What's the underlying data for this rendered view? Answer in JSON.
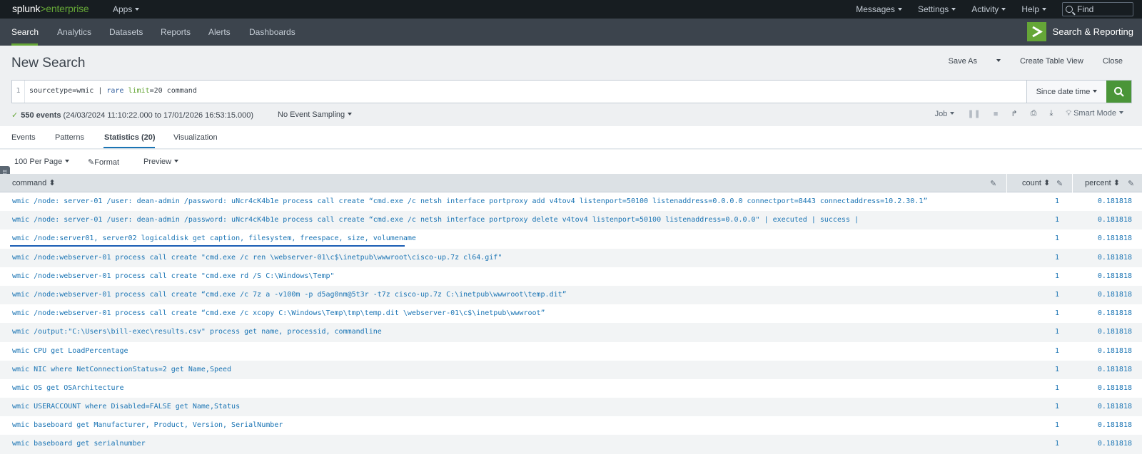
{
  "topbar": {
    "logo_brand": "splunk",
    "logo_gt": ">",
    "logo_product": "enterprise",
    "apps_label": "Apps",
    "menu": [
      "Messages",
      "Settings",
      "Activity",
      "Help"
    ],
    "find_placeholder": "Find"
  },
  "navbar": {
    "items": [
      "Search",
      "Analytics",
      "Datasets",
      "Reports",
      "Alerts",
      "Dashboards"
    ],
    "active": "Search",
    "app_name": "Search & Reporting",
    "accent_color": "#65a637"
  },
  "page": {
    "title": "New Search",
    "actions": {
      "save_as": "Save As",
      "create_table_view": "Create Table View",
      "close": "Close"
    }
  },
  "search": {
    "line_number": "1",
    "query_plain": "sourcetype=wmic | ",
    "query_command": "rare",
    "query_arg": "limit",
    "query_rest": "=20 command",
    "time_range": "Since date time"
  },
  "status": {
    "events_count": "550 events",
    "range": "(24/03/2024 11:10:22.000 to 17/01/2026 16:53:15.000)",
    "sampling": "No Event Sampling",
    "job": "Job",
    "mode": "Smart Mode"
  },
  "tabs": [
    "Events",
    "Patterns",
    "Statistics (20)",
    "Visualization"
  ],
  "active_tab": "Statistics (20)",
  "options": {
    "per_page": "100 Per Page",
    "format": "Format",
    "preview": "Preview"
  },
  "table": {
    "columns": [
      "command",
      "count",
      "percent"
    ],
    "rows": [
      {
        "command": "wmic /node: server-01 /user: dean-admin /password: uNcr4cK4b1e process call create “cmd.exe /c netsh interface portproxy add v4tov4 listenport=50100 listenaddress=0.0.0.0 connectport=8443 connectaddress=10.2.30.1”",
        "count": "1",
        "percent": "0.181818"
      },
      {
        "command": "wmic /node: server-01 /user: dean-admin /password: uNcr4cK4b1e process call create “cmd.exe /c netsh interface portproxy delete v4tov4 listenport=50100 listenaddress=0.0.0.0\" | executed | success |",
        "count": "1",
        "percent": "0.181818"
      },
      {
        "command": "wmic /node:server01, server02 logicaldisk get caption, filesystem, freespace, size, volumename",
        "count": "1",
        "percent": "0.181818"
      },
      {
        "command": "wmic /node:webserver-01 process call create \"cmd.exe /c ren \\webserver-01\\c$\\inetpub\\wwwroot\\cisco-up.7z cl64.gif\"",
        "count": "1",
        "percent": "0.181818"
      },
      {
        "command": "wmic /node:webserver-01 process call create \"cmd.exe rd /S C:\\Windows\\Temp\"",
        "count": "1",
        "percent": "0.181818"
      },
      {
        "command": "wmic /node:webserver-01 process call create “cmd.exe /c 7z a -v100m -p d5ag0nm@5t3r -t7z cisco-up.7z C:\\inetpub\\wwwroot\\temp.dit”",
        "count": "1",
        "percent": "0.181818"
      },
      {
        "command": "wmic /node:webserver-01 process call create “cmd.exe /c xcopy C:\\Windows\\Temp\\tmp\\temp.dit \\webserver-01\\c$\\inetpub\\wwwroot”",
        "count": "1",
        "percent": "0.181818"
      },
      {
        "command": "wmic /output:\"C:\\Users\\bill-exec\\results.csv\" process get name, processid, commandline",
        "count": "1",
        "percent": "0.181818"
      },
      {
        "command": "wmic CPU get LoadPercentage",
        "count": "1",
        "percent": "0.181818"
      },
      {
        "command": "wmic NIC where NetConnectionStatus=2 get Name,Speed",
        "count": "1",
        "percent": "0.181818"
      },
      {
        "command": "wmic OS get OSArchitecture",
        "count": "1",
        "percent": "0.181818"
      },
      {
        "command": "wmic USERACCOUNT where Disabled=FALSE get Name,Status",
        "count": "1",
        "percent": "0.181818"
      },
      {
        "command": "wmic baseboard get Manufacturer, Product, Version, SerialNumber",
        "count": "1",
        "percent": "0.181818"
      },
      {
        "command": "wmic baseboard get serialnumber",
        "count": "1",
        "percent": "0.181818"
      }
    ]
  }
}
